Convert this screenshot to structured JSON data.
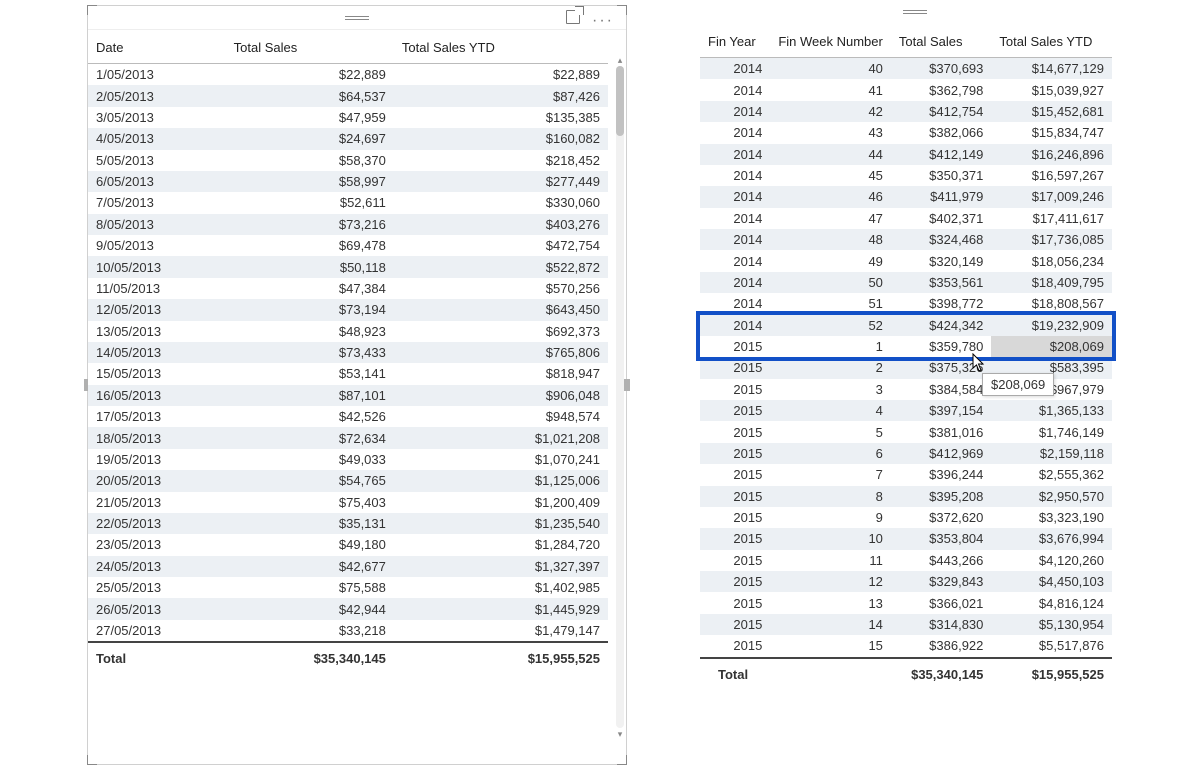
{
  "left": {
    "headers": [
      "Date",
      "Total Sales",
      "Total Sales YTD"
    ],
    "rows": [
      [
        "1/05/2013",
        "$22,889",
        "$22,889"
      ],
      [
        "2/05/2013",
        "$64,537",
        "$87,426"
      ],
      [
        "3/05/2013",
        "$47,959",
        "$135,385"
      ],
      [
        "4/05/2013",
        "$24,697",
        "$160,082"
      ],
      [
        "5/05/2013",
        "$58,370",
        "$218,452"
      ],
      [
        "6/05/2013",
        "$58,997",
        "$277,449"
      ],
      [
        "7/05/2013",
        "$52,611",
        "$330,060"
      ],
      [
        "8/05/2013",
        "$73,216",
        "$403,276"
      ],
      [
        "9/05/2013",
        "$69,478",
        "$472,754"
      ],
      [
        "10/05/2013",
        "$50,118",
        "$522,872"
      ],
      [
        "11/05/2013",
        "$47,384",
        "$570,256"
      ],
      [
        "12/05/2013",
        "$73,194",
        "$643,450"
      ],
      [
        "13/05/2013",
        "$48,923",
        "$692,373"
      ],
      [
        "14/05/2013",
        "$73,433",
        "$765,806"
      ],
      [
        "15/05/2013",
        "$53,141",
        "$818,947"
      ],
      [
        "16/05/2013",
        "$87,101",
        "$906,048"
      ],
      [
        "17/05/2013",
        "$42,526",
        "$948,574"
      ],
      [
        "18/05/2013",
        "$72,634",
        "$1,021,208"
      ],
      [
        "19/05/2013",
        "$49,033",
        "$1,070,241"
      ],
      [
        "20/05/2013",
        "$54,765",
        "$1,125,006"
      ],
      [
        "21/05/2013",
        "$75,403",
        "$1,200,409"
      ],
      [
        "22/05/2013",
        "$35,131",
        "$1,235,540"
      ],
      [
        "23/05/2013",
        "$49,180",
        "$1,284,720"
      ],
      [
        "24/05/2013",
        "$42,677",
        "$1,327,397"
      ],
      [
        "25/05/2013",
        "$75,588",
        "$1,402,985"
      ],
      [
        "26/05/2013",
        "$42,944",
        "$1,445,929"
      ],
      [
        "27/05/2013",
        "$33,218",
        "$1,479,147"
      ]
    ],
    "totals": [
      "Total",
      "$35,340,145",
      "$15,955,525"
    ]
  },
  "right": {
    "headers": [
      "Fin Year",
      "Fin Week Number",
      "Total Sales",
      "Total Sales YTD"
    ],
    "rows": [
      [
        "2014",
        "40",
        "$370,693",
        "$14,677,129"
      ],
      [
        "2014",
        "41",
        "$362,798",
        "$15,039,927"
      ],
      [
        "2014",
        "42",
        "$412,754",
        "$15,452,681"
      ],
      [
        "2014",
        "43",
        "$382,066",
        "$15,834,747"
      ],
      [
        "2014",
        "44",
        "$412,149",
        "$16,246,896"
      ],
      [
        "2014",
        "45",
        "$350,371",
        "$16,597,267"
      ],
      [
        "2014",
        "46",
        "$411,979",
        "$17,009,246"
      ],
      [
        "2014",
        "47",
        "$402,371",
        "$17,411,617"
      ],
      [
        "2014",
        "48",
        "$324,468",
        "$17,736,085"
      ],
      [
        "2014",
        "49",
        "$320,149",
        "$18,056,234"
      ],
      [
        "2014",
        "50",
        "$353,561",
        "$18,409,795"
      ],
      [
        "2014",
        "51",
        "$398,772",
        "$18,808,567"
      ],
      [
        "2014",
        "52",
        "$424,342",
        "$19,232,909"
      ],
      [
        "2015",
        "1",
        "$359,780",
        "$208,069"
      ],
      [
        "2015",
        "2",
        "$375,326",
        "$583,395"
      ],
      [
        "2015",
        "3",
        "$384,584",
        "$967,979"
      ],
      [
        "2015",
        "4",
        "$397,154",
        "$1,365,133"
      ],
      [
        "2015",
        "5",
        "$381,016",
        "$1,746,149"
      ],
      [
        "2015",
        "6",
        "$412,969",
        "$2,159,118"
      ],
      [
        "2015",
        "7",
        "$396,244",
        "$2,555,362"
      ],
      [
        "2015",
        "8",
        "$395,208",
        "$2,950,570"
      ],
      [
        "2015",
        "9",
        "$372,620",
        "$3,323,190"
      ],
      [
        "2015",
        "10",
        "$353,804",
        "$3,676,994"
      ],
      [
        "2015",
        "11",
        "$443,266",
        "$4,120,260"
      ],
      [
        "2015",
        "12",
        "$329,843",
        "$4,450,103"
      ],
      [
        "2015",
        "13",
        "$366,021",
        "$4,816,124"
      ],
      [
        "2015",
        "14",
        "$314,830",
        "$5,130,954"
      ],
      [
        "2015",
        "15",
        "$386,922",
        "$5,517,876"
      ]
    ],
    "totals": [
      "Total",
      "",
      "$35,340,145",
      "$15,955,525"
    ],
    "highlight_rows": [
      12,
      13
    ],
    "tooltip_value": "$208,069",
    "selected_cell": {
      "row": 13,
      "col": 3
    }
  }
}
